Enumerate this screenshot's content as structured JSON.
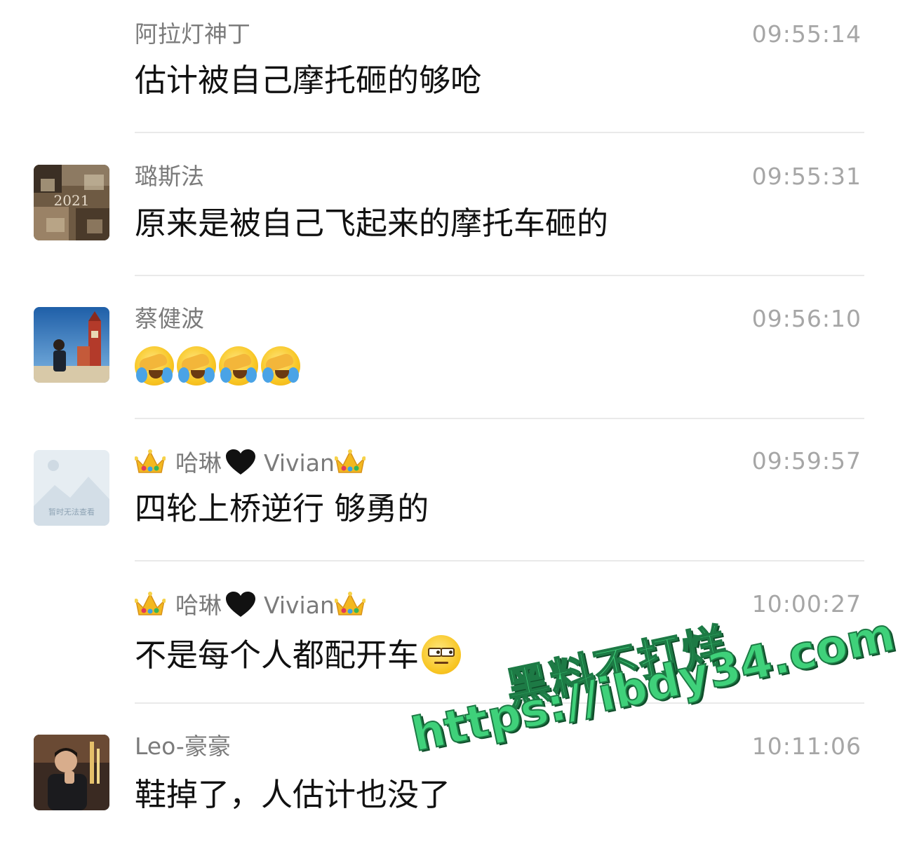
{
  "messages": [
    {
      "sender": "阿拉灯神丁",
      "time": "09:55:14",
      "text": "估计被自己摩托砸的够呛",
      "avatar": "none"
    },
    {
      "sender": "璐斯法",
      "time": "09:55:31",
      "text": "原来是被自己飞起来的摩托车砸的",
      "avatar": "photo-2021"
    },
    {
      "sender": "蔡健波",
      "time": "09:56:10",
      "text": "",
      "emoji": [
        "face-palm-crying-icon",
        "face-palm-crying-icon",
        "face-palm-crying-icon",
        "face-palm-crying-icon"
      ],
      "avatar": "photo-castle"
    },
    {
      "sender": "哈琳",
      "sender_suffix": "Vivian",
      "time": "09:59:57",
      "text": "四轮上桥逆行 够勇的",
      "avatar": "placeholder",
      "avatar_placeholder_text": "暂时无法查看"
    },
    {
      "sender": "哈琳",
      "sender_suffix": "Vivian",
      "time": "10:00:27",
      "text": "不是每个人都配开车",
      "text_emoji": "unamused-face-icon",
      "avatar": "none"
    },
    {
      "sender": "Leo-豪豪",
      "time": "10:11:06",
      "text": "鞋掉了，人估计也没了",
      "avatar": "photo-man"
    }
  ],
  "watermark": {
    "line1": "黑料不打烊",
    "line2": "https://ibdy34.com"
  },
  "colors": {
    "name": "#7b7b7b",
    "time": "#a6a6a6",
    "text": "#111111",
    "divider": "#e9e9e9",
    "watermark": "#3fd17a"
  }
}
